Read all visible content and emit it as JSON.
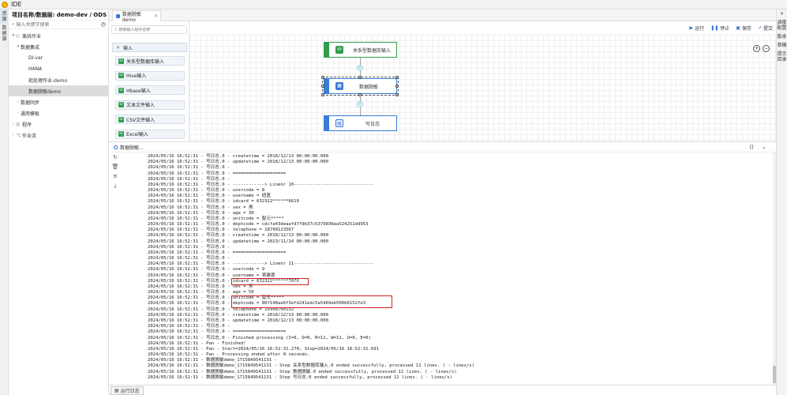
{
  "app": {
    "title": "IDE"
  },
  "left_rail": {
    "items": [
      "资源",
      "数据源"
    ]
  },
  "right_rail": {
    "items": [
      "调度配置",
      "版本",
      "草稿",
      "提示目录"
    ]
  },
  "tree": {
    "project_title": "项目名称/数据层:  demo-dev / ODS",
    "search_placeholder": "输入关键字搜索",
    "nodes": [
      {
        "label": "离线作业",
        "level": 0,
        "arrow": "▾",
        "icon": "◇"
      },
      {
        "label": "数据集成",
        "level": 1,
        "arrow": "▾",
        "icon": ""
      },
      {
        "label": "DI-var",
        "level": 2,
        "arrow": "",
        "icon": ""
      },
      {
        "label": "HANA",
        "level": 2,
        "arrow": "",
        "icon": ""
      },
      {
        "label": "批处理作业-demo",
        "level": 2,
        "arrow": "",
        "icon": ""
      },
      {
        "label": "数据脱敏demo",
        "level": 2,
        "arrow": "",
        "icon": "",
        "selected": true
      },
      {
        "label": "数据同步",
        "level": 1,
        "arrow": "›",
        "icon": ""
      },
      {
        "label": "通用模板",
        "level": 1,
        "arrow": "›",
        "icon": ""
      },
      {
        "label": "程序",
        "level": 0,
        "arrow": "›",
        "icon": "◎"
      },
      {
        "label": "作业流",
        "level": 0,
        "arrow": "›",
        "icon": "⌥"
      }
    ]
  },
  "tabs": [
    {
      "label": "数据脱敏demo"
    }
  ],
  "components": {
    "search_placeholder": "搜索输入组件名称",
    "group": "输入",
    "items": [
      "关系型数据库输入",
      "Hive输入",
      "Hbase输入",
      "文本文件输入",
      "CSV文件输入",
      "Excel输入"
    ]
  },
  "toolbar": {
    "run": "运行",
    "stop": "停止",
    "save": "保存",
    "submit": "提交"
  },
  "flow": {
    "nodes": [
      {
        "label": "关系型数据库输入",
        "color": "#2e9d4a"
      },
      {
        "label": "数据脱敏",
        "color": "#3a7bd5"
      },
      {
        "label": "写日志",
        "color": "#3a7bd5"
      }
    ]
  },
  "log": {
    "title": "数据脱敏...",
    "lines": [
      "2024/05/16 16:52:31 - 写日志.0 - createtime = 2018/12/13 00:00:00.000",
      "2024/05/16 16:52:31 - 写日志.0 - updatetime = 2018/12/13 00:00:00.000",
      "2024/05/16 16:52:31 - 写日志.0 -",
      "2024/05/16 16:52:31 - 写日志.0 - ====================",
      "2024/05/16 16:52:31 - 写日志.0 -",
      "2024/05/16 16:52:31 - 写日志.0 - ------------> Linenr 10------------------------------",
      "2024/05/16 16:52:31 - 写日志.0 - usercode = 8",
      "2024/05/16 16:52:31 - 写日志.0 - username = 纽盖",
      "2024/05/16 16:52:31 - 写日志.0 - idcard = 632322******6619",
      "2024/05/16 16:52:31 - 写日志.0 - sex = 男",
      "2024/05/16 16:52:31 - 写日志.0 - age = 30",
      "2024/05/16 16:52:31 - 写日志.0 - unitcode = 智元*****",
      "2024/05/16 16:52:31 - 写日志.0 - deptcode = cdcfa43deaafd7f9b37c5379036ea524251dd953",
      "2024/05/16 16:52:31 - 写日志.0 - telephone = 18790123567",
      "2024/05/16 16:52:31 - 写日志.0 - createtime = 2018/12/13 00:00:00.000",
      "2024/05/16 16:52:31 - 写日志.0 - updatetime = 2023/11/14 00:00:00.000",
      "2024/05/16 16:52:31 - 写日志.0 -",
      "2024/05/16 16:52:31 - 写日志.0 - ====================",
      "2024/05/16 16:52:31 - 写日志.0 -",
      "2024/05/16 16:52:31 - 写日志.0 - ------------> Linenr 11------------------------------",
      "2024/05/16 16:52:31 - 写日志.0 - usercode = 9",
      "2024/05/16 16:52:31 - 写日志.0 - username = 蒋建恩",
      "2024/05/16 16:52:31 - 写日志.0 - idcard = 632322******707X",
      "2024/05/16 16:52:31 - 写日志.0 - sex = 男",
      "2024/05/16 16:52:31 - 写日志.0 - age = 50",
      "2024/05/16 16:52:31 - 写日志.0 - unitcode = 智元*****",
      "2024/05/16 16:52:31 - 写日志.0 - deptcode = 80f148ae6f3efd241edc5a5469eb500b6152fe3",
      "2024/05/16 16:52:31 - 写日志.0 - telephone = 15998760132",
      "2024/05/16 16:52:31 - 写日志.0 - createtime = 2018/12/13 00:00:00.000",
      "2024/05/16 16:52:31 - 写日志.0 - updatetime = 2018/12/13 00:00:00.000",
      "2024/05/16 16:52:31 - 写日志.0 -",
      "2024/05/16 16:52:31 - 写日志.0 - ====================",
      "2024/05/16 16:52:31 - 写日志.0 - Finished processing (I=0, O=0, R=11, W=11, U=0, E=0)",
      "2024/05/16 16:52:31 - Pan - Finished!",
      "2024/05/16 16:52:31 - Pan - Start=2024/05/16 16:52:31.270, Stop=2024/05/16 16:52:31.691",
      "2024/05/16 16:52:31 - Pan - Processing ended after 0 seconds.",
      "2024/05/16 16:52:31 - 数据脱敏demo_1715849541131 -",
      "2024/05/16 16:52:31 - 数据脱敏demo_1715849541131 - Step 关系型数据库输入.0 ended successfully, processed 11 lines. ( - lines/s)",
      "2024/05/16 16:52:31 - 数据脱敏demo_1715849541131 - Step 数据脱敏.0 ended successfully, processed 11 lines. ( - lines/s)",
      "2024/05/16 16:52:31 - 数据脱敏demo_1715849541131 - Step 写日志.0 ended successfully, processed 11 lines. ( - lines/s)"
    ]
  },
  "footer": {
    "tab": "运行日志"
  }
}
